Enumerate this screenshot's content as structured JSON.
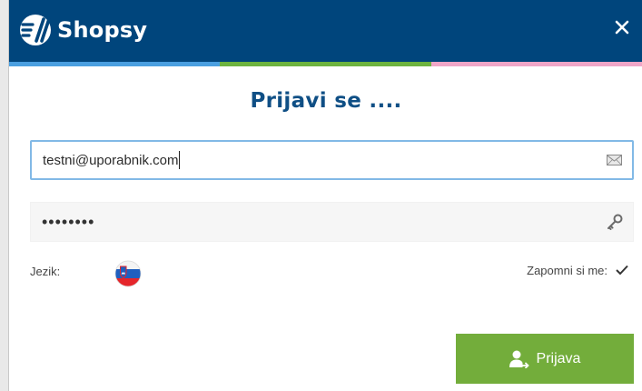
{
  "header": {
    "brand_name": "Shopsy",
    "logo_icon": "shopsy-logo-icon",
    "close_icon": "close-icon",
    "background_color": "#00457c",
    "stripe_colors": [
      "#4a9fe0",
      "#6db33f",
      "#f0a6c8"
    ]
  },
  "form": {
    "title": "Prijavi se ....",
    "email": {
      "value": "testni@uporabnik.com",
      "icon": "envelope-icon"
    },
    "password": {
      "value": "••••••••",
      "icon": "key-icon"
    },
    "language": {
      "label": "Jezik:",
      "selected_flag": "slovenia-flag-icon"
    },
    "remember": {
      "label": "Zapomni si me:",
      "checked": true
    },
    "submit": {
      "label": "Prijava",
      "icon": "user-login-icon",
      "color": "#73ad3b"
    }
  }
}
